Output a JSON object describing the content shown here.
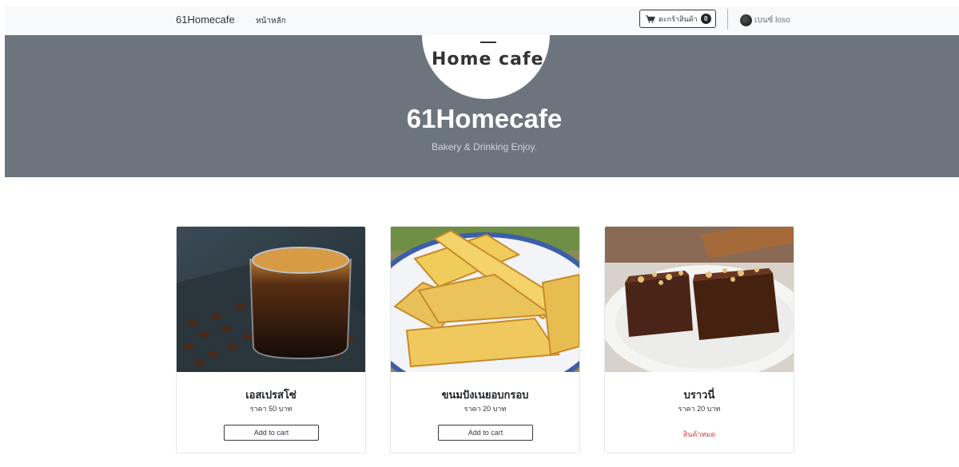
{
  "nav": {
    "brand": "61Homecafe",
    "home": "หน้าหลัก",
    "cart_label": "ตะกร้าสินค้า",
    "cart_count": "0",
    "user_name": "เบนซ์ loso"
  },
  "hero": {
    "logo_text": "Home cafe",
    "title": "61Homecafe",
    "subtitle": "Bakery & Drinking Enjoy."
  },
  "products": [
    {
      "name": "เอสเปรสโซ่",
      "price": "ราคา 50 บาท",
      "action": "Add to cart",
      "image_icon": "espresso-image"
    },
    {
      "name": "ขนมปังเนยอบกรอบ",
      "price": "ราคา 20 บาท",
      "action": "Add to cart",
      "image_icon": "butter-toast-image"
    },
    {
      "name": "บราวนี่",
      "price": "ราคา 20 บาท",
      "status": "สินค้าหมด",
      "image_icon": "brownie-image"
    }
  ],
  "colors": {
    "navbar_bg": "#f8f9fa",
    "hero_bg": "#6c757d",
    "sold_out": "#dc3545"
  }
}
